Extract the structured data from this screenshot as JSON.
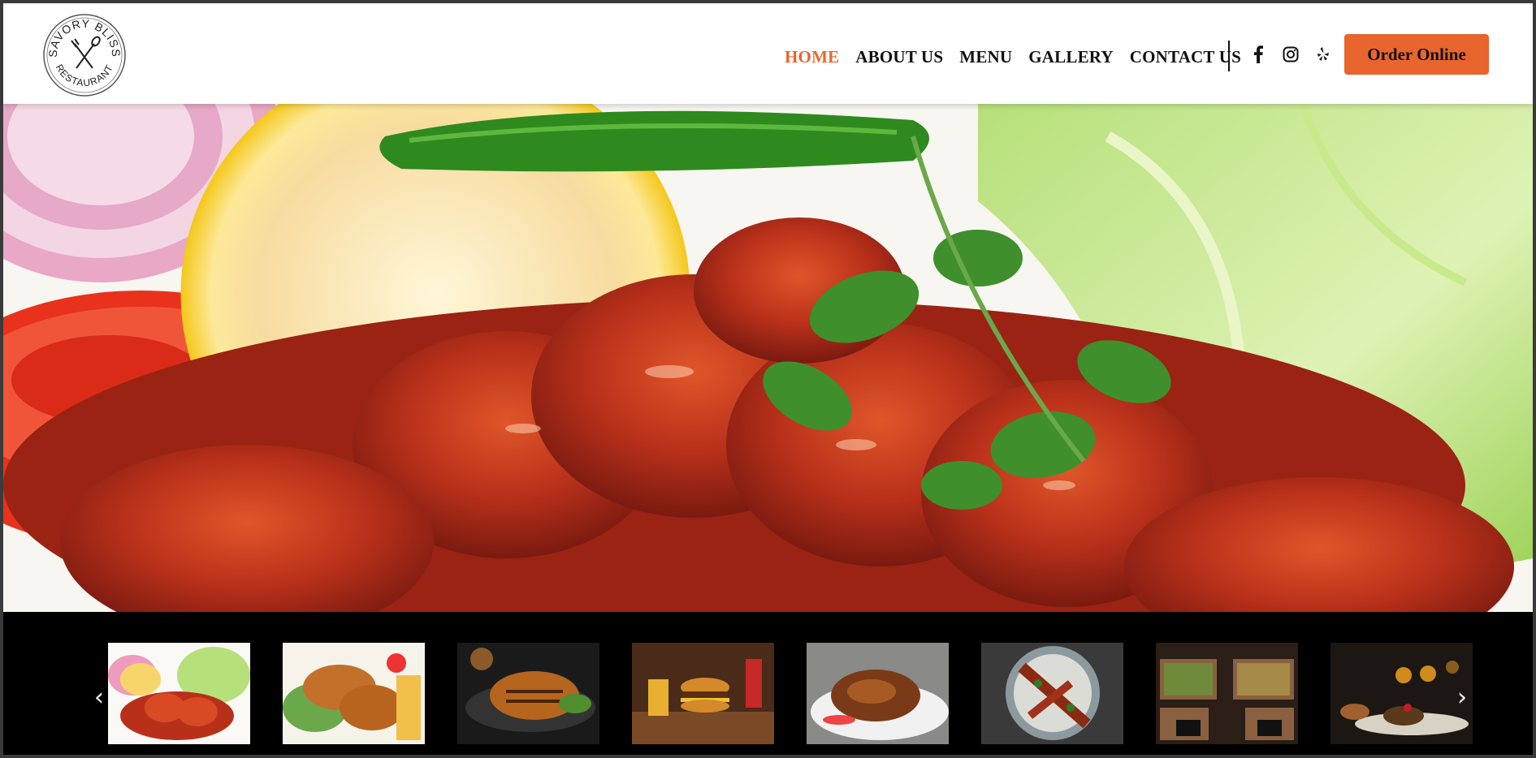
{
  "brand": {
    "logo_top": "SAVORY BLISS",
    "logo_bottom": "RESTAURANT",
    "accent": "#e8652e"
  },
  "nav": {
    "items": [
      "HOME",
      "ABOUT US",
      "MENU",
      "GALLERY",
      "CONTACT US"
    ],
    "active": "HOME"
  },
  "social": [
    "facebook-icon",
    "instagram-icon",
    "yelp-icon"
  ],
  "order_button": "Order Online",
  "hero": {
    "image": "chicken-65-dish-with-lemon-onion-tomato-lettuce"
  },
  "gallery": {
    "thumbnails": [
      "chicken-65-plate",
      "fried-drumsticks-with-fries",
      "grilled-chicken-platter",
      "burger-and-fries-meal",
      "roast-chicken-plate",
      "kebab-skewers-with-rice",
      "salad-bar-trays",
      "plated-dessert"
    ],
    "prev": "‹",
    "next": "›"
  }
}
